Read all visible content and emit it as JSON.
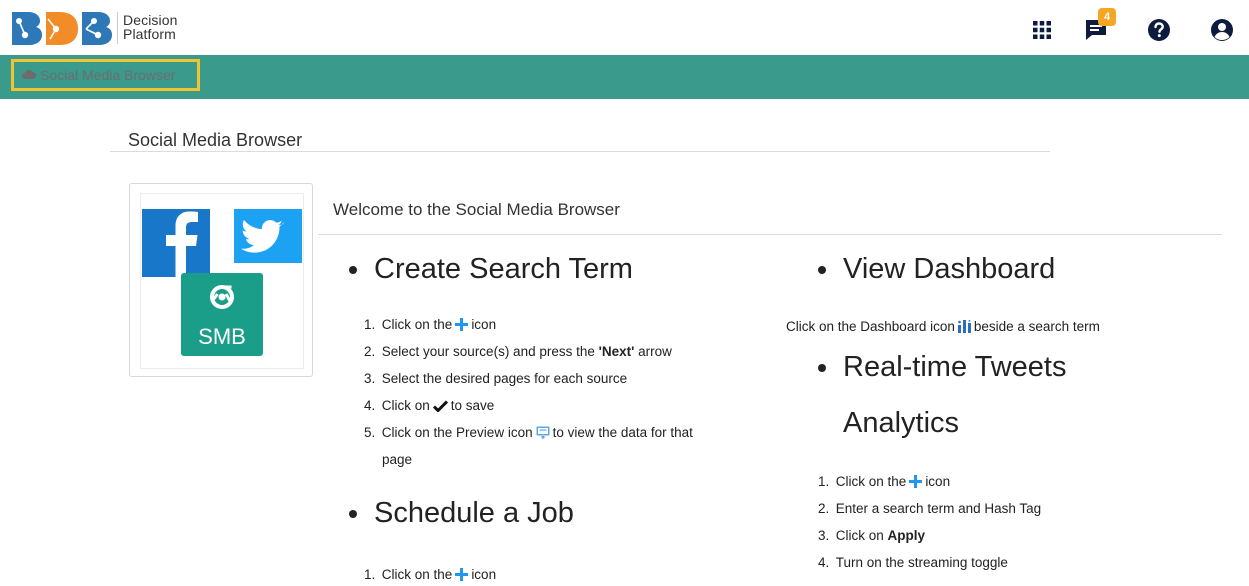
{
  "header": {
    "brand_line1": "Decision",
    "brand_line2": "Platform",
    "notification_count": "4",
    "icons": [
      "apps-grid-icon",
      "messages-icon",
      "help-icon",
      "user-icon"
    ]
  },
  "navbar": {
    "breadcrumb_label": "Social Media Browser"
  },
  "page": {
    "title": "Social Media Browser",
    "welcome": "Welcome to the Social Media Browser",
    "thumbnail_label": "SMB"
  },
  "create": {
    "heading": "Create Search Term",
    "steps": [
      {
        "num": "1.",
        "before": "Click on the",
        "after": "icon"
      },
      {
        "num": "2.",
        "before": "Select your source(s) and press the",
        "bold": "'Next'",
        "after": "arrow"
      },
      {
        "num": "3.",
        "text": "Select the desired pages for each source"
      },
      {
        "num": "4.",
        "before": "Click on",
        "after": "to save"
      },
      {
        "num": "5.",
        "before": "Click on the Preview icon",
        "after": "to view the data for that"
      },
      {
        "cont": "page"
      }
    ]
  },
  "schedule": {
    "heading": "Schedule a Job",
    "steps": [
      {
        "num": "1.",
        "before": "Click on the",
        "after": "icon"
      }
    ]
  },
  "dashboard": {
    "heading": "View Dashboard",
    "before": "Click on the Dashboard icon",
    "after": "beside a search term"
  },
  "realtime": {
    "heading_line1": "Real-time Tweets",
    "heading_line2": "Analytics",
    "steps": [
      {
        "num": "1.",
        "before": "Click on the",
        "after": "icon"
      },
      {
        "num": "2.",
        "text": "Enter a search term and Hash Tag"
      },
      {
        "num": "3.",
        "before": "Click on",
        "bold": "Apply"
      },
      {
        "num": "4.",
        "text": "Turn on the streaming toggle"
      }
    ]
  },
  "colors": {
    "navbar": "#3a9a8c",
    "highlight": "#f2c233",
    "badge": "#f5a623",
    "plus": "#2196f3",
    "facebook": "#1877c9",
    "twitter": "#1da1f2",
    "smb": "#1a9e8a",
    "header_icons": "#0d1b3e"
  }
}
